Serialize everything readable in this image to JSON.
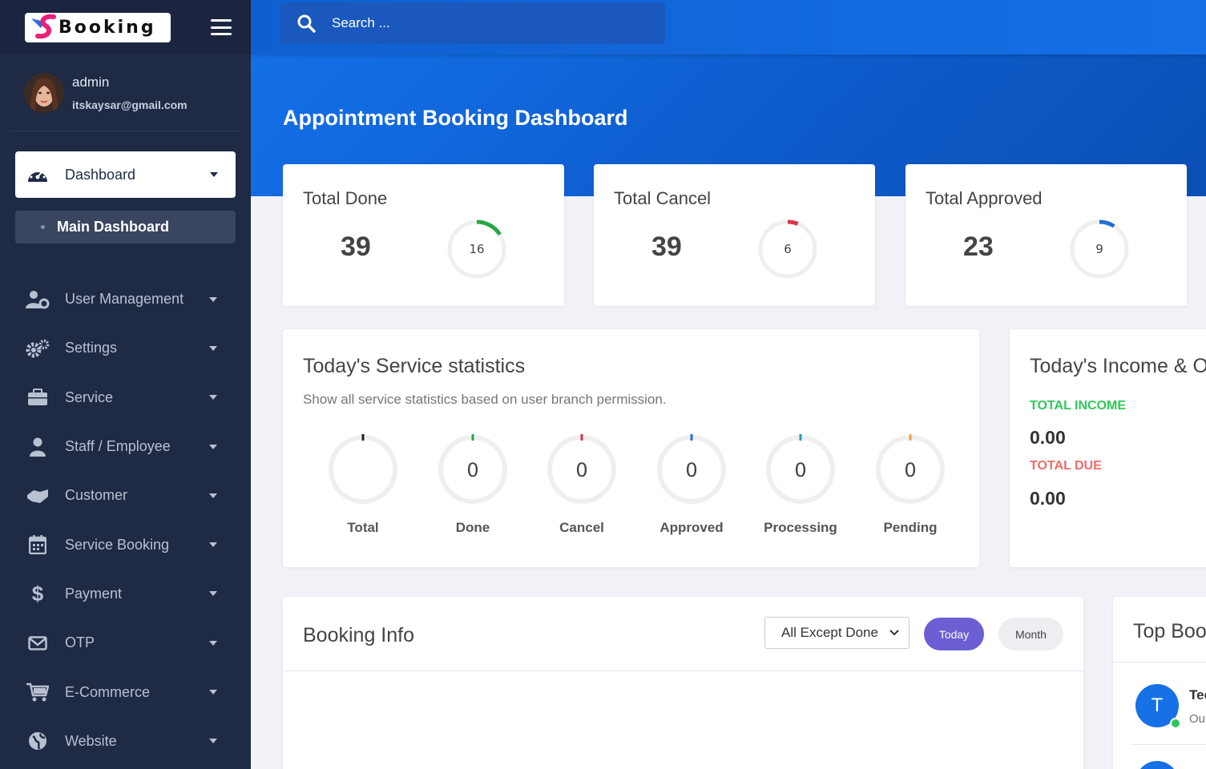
{
  "brand": {
    "name": "Booking"
  },
  "user": {
    "name": "admin",
    "email": "itskaysar@gmail.com"
  },
  "nav": {
    "active": {
      "label": "Dashboard",
      "icon": "dashboard-gauge-icon"
    },
    "sub_active": {
      "label": "Main Dashboard"
    },
    "items": [
      {
        "label": "User Management",
        "icon": "user-gear-icon"
      },
      {
        "label": "Settings",
        "icon": "gears-icon"
      },
      {
        "label": "Service",
        "icon": "briefcase-icon"
      },
      {
        "label": "Staff / Employee",
        "icon": "staff-icon"
      },
      {
        "label": "Customer",
        "icon": "handshake-icon"
      },
      {
        "label": "Service Booking",
        "icon": "calendar-icon"
      },
      {
        "label": "Payment",
        "icon": "dollar-icon"
      },
      {
        "label": "OTP",
        "icon": "envelope-icon"
      },
      {
        "label": "E-Commerce",
        "icon": "cart-icon"
      },
      {
        "label": "Website",
        "icon": "globe-icon"
      }
    ]
  },
  "search": {
    "placeholder": "Search ..."
  },
  "page": {
    "title": "Appointment Booking Dashboard"
  },
  "stats": [
    {
      "title": "Total Done",
      "value": "39",
      "ring_value": "16",
      "color": "#28a745",
      "fraction": 0.16
    },
    {
      "title": "Total Cancel",
      "value": "39",
      "ring_value": "6",
      "color": "#dc3545",
      "fraction": 0.06
    },
    {
      "title": "Total Approved",
      "value": "23",
      "ring_value": "9",
      "color": "#1f6fd8",
      "fraction": 0.09
    }
  ],
  "service_stats": {
    "title": "Today's Service statistics",
    "subtitle": "Show all service statistics based on user branch permission.",
    "items": [
      {
        "label": "Total",
        "value": "",
        "color": "#222222"
      },
      {
        "label": "Done",
        "value": "0",
        "color": "#28a745"
      },
      {
        "label": "Cancel",
        "value": "0",
        "color": "#dc3545"
      },
      {
        "label": "Approved",
        "value": "0",
        "color": "#1f6fd8"
      },
      {
        "label": "Processing",
        "value": "0",
        "color": "#17a2b8"
      },
      {
        "label": "Pending",
        "value": "0",
        "color": "#f0a040"
      }
    ]
  },
  "income": {
    "title": "Today's Income & Ot",
    "total_income_label": "TOTAL INCOME",
    "total_income_value": "0.00",
    "total_due_label": "TOTAL DUE",
    "total_due_value": "0.00",
    "income_color": "#2fc85a",
    "due_color": "#f06a6a"
  },
  "booking": {
    "title": "Booking Info",
    "filter_selected": "All Except Done",
    "today_label": "Today",
    "month_label": "Month"
  },
  "top": {
    "title": "Top Bool",
    "entry_initial": "T",
    "entry_name": "Tee",
    "entry_sub": "Ou"
  }
}
